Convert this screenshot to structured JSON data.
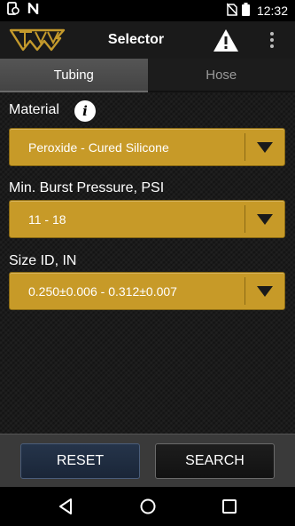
{
  "status_bar": {
    "time": "12:32",
    "icons": [
      "phone-sync-icon",
      "no-signal-icon",
      "no-sim-icon",
      "battery-icon"
    ]
  },
  "app_bar": {
    "title": "Selector",
    "logo": "tw-logo",
    "actions": [
      "warning-icon",
      "overflow-menu-icon"
    ]
  },
  "tabs": [
    {
      "label": "Tubing",
      "active": true
    },
    {
      "label": "Hose",
      "active": false
    }
  ],
  "fields": {
    "material": {
      "label": "Material",
      "value": "Peroxide - Cured Silicone"
    },
    "pressure": {
      "label": "Min. Burst Pressure, PSI",
      "value": "11 - 18"
    },
    "size": {
      "label": "Size ID, IN",
      "value": "0.250±0.006 - 0.312±0.007"
    }
  },
  "buttons": {
    "reset": "RESET",
    "search": "SEARCH"
  },
  "colors": {
    "dropdown": "#c79a28",
    "reset_button": "#25344a",
    "accent_logo": "#c49a2c"
  }
}
